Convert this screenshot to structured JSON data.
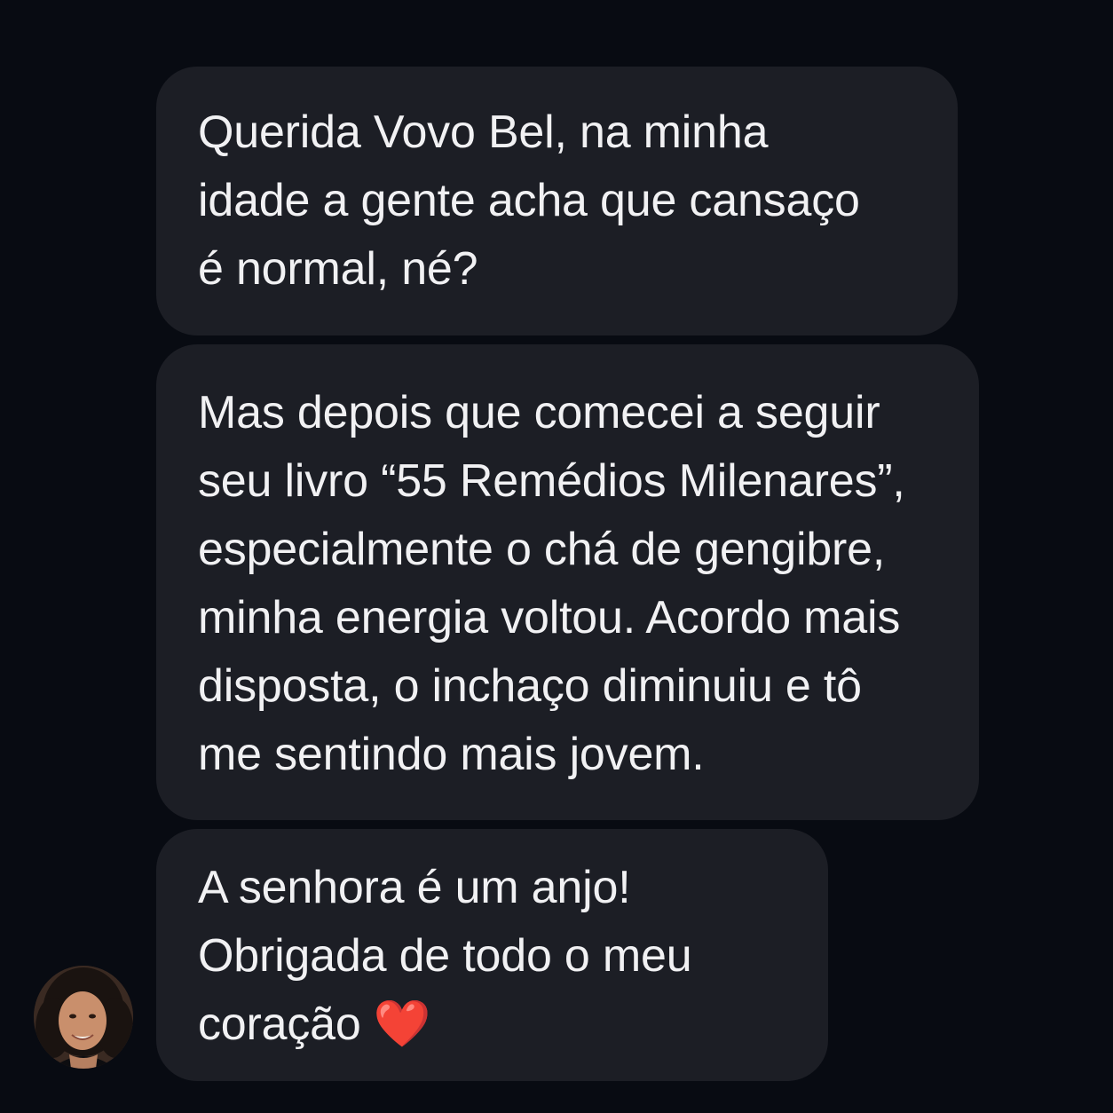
{
  "conversation": {
    "messages": [
      {
        "text": "Querida Vovo Bel, na minha\nidade a gente acha que cansaço\né normal, né?"
      },
      {
        "text": "Mas depois que comecei a seguir\nseu livro “55 Remédios Milenares”,\nespecialmente o chá de gengibre,\nminha energia voltou. Acordo mais\ndisposta, o inchaço diminuiu e tô\nme sentindo mais jovem."
      },
      {
        "text": "A senhora é um anjo!\nObrigada de todo o meu\ncoração",
        "emoji": "❤️"
      }
    ],
    "sender_avatar": "woman-avatar-photo"
  },
  "colors": {
    "background": "#080b12",
    "bubble": "#1c1e25",
    "text": "#f1f1f3",
    "heart": "#e0202c"
  }
}
